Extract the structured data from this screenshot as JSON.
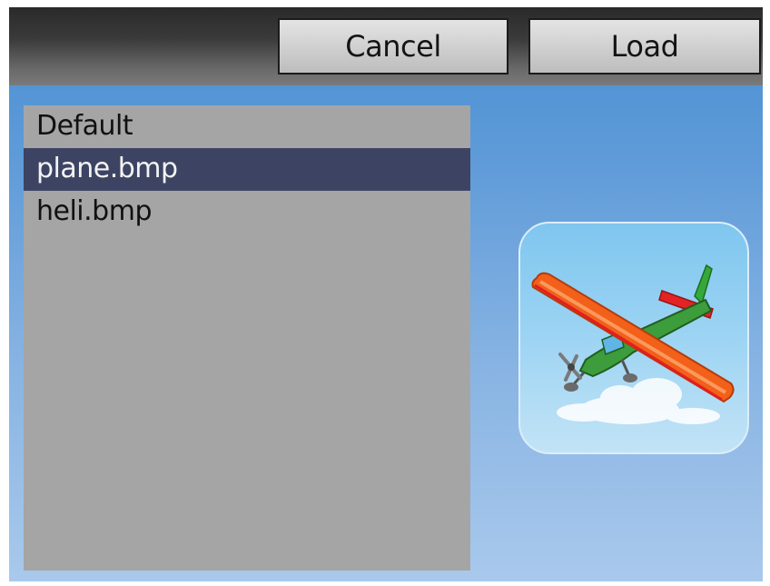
{
  "toolbar": {
    "cancel_label": "Cancel",
    "load_label": "Load"
  },
  "file_list": {
    "items": [
      {
        "label": "Default",
        "selected": false
      },
      {
        "label": "plane.bmp",
        "selected": true
      },
      {
        "label": "heli.bmp",
        "selected": false
      }
    ]
  },
  "preview": {
    "icon": "plane-icon"
  },
  "colors": {
    "selection": "#3d4463",
    "list_background": "#a5a5a5",
    "plane_wing": "#f2601a",
    "plane_body": "#3a9a3a"
  }
}
